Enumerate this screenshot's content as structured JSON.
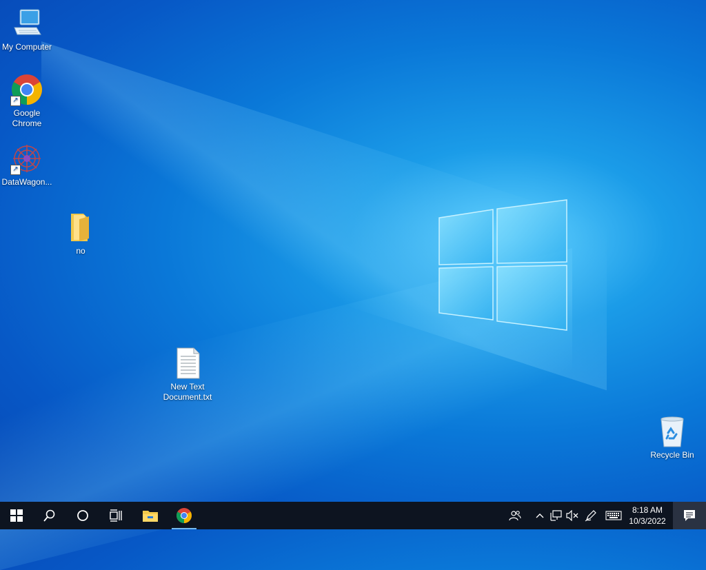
{
  "desktop": {
    "icons": [
      {
        "label": "My Computer"
      },
      {
        "label": "Google Chrome"
      },
      {
        "label": "DataWagon..."
      },
      {
        "label": "no"
      },
      {
        "label": "New Text Document.txt"
      },
      {
        "label": "Recycle Bin"
      }
    ]
  },
  "taskbar": {
    "clock_time": "8:18 AM",
    "clock_date": "10/3/2022"
  },
  "colors": {
    "taskbar_bg": "#0d1420",
    "desktop_accent": "#0a78d8"
  }
}
